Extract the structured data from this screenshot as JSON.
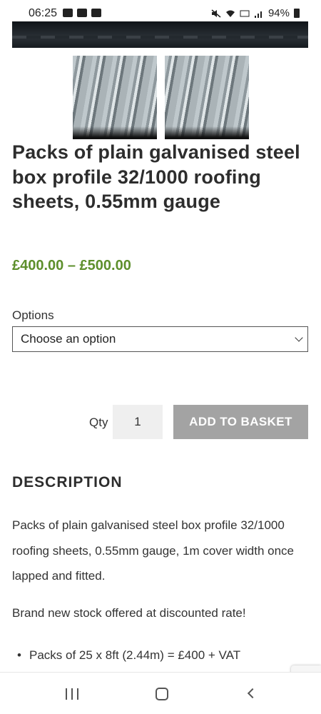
{
  "status_bar": {
    "time": "06:25",
    "battery": "94%",
    "icons": [
      "image-icon",
      "notification-icon",
      "vpn-icon",
      "mute-icon",
      "wifi-icon",
      "volte-icon",
      "signal-icon",
      "battery-icon"
    ]
  },
  "product": {
    "title": "Packs of plain galvanised steel box profile 32/1000 roofing sheets, 0.55mm gauge",
    "price": "£400.00 – £500.00",
    "options_label": "Options",
    "options_selected": "Choose an option",
    "qty_label": "Qty",
    "qty_value": "1",
    "add_button": "ADD TO BASKET"
  },
  "description": {
    "heading": "DESCRIPTION",
    "paragraph1": "Packs of plain galvanised steel box profile 32/1000 roofing sheets, 0.55mm gauge, 1m cover width once lapped and fitted.",
    "paragraph2": "Brand new stock offered at discounted rate!",
    "bullets": [
      "Packs of 25 x 8ft (2.44m) = £400 + VAT"
    ]
  },
  "colors": {
    "price": "#5d8f2c",
    "button_bg": "#a3a3a3",
    "qty_bg": "#efefef"
  }
}
